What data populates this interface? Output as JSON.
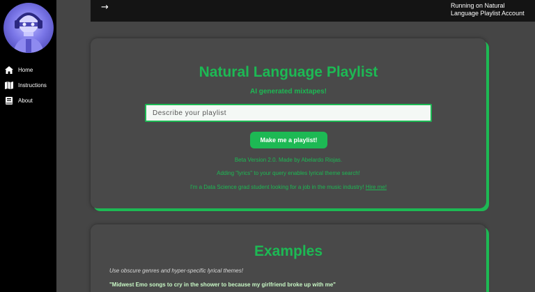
{
  "sidebar": {
    "items": [
      {
        "label": "Home",
        "icon": "home-icon"
      },
      {
        "label": "Instructions",
        "icon": "map-icon"
      },
      {
        "label": "About",
        "icon": "book-icon"
      }
    ]
  },
  "topbar": {
    "arrow": "→",
    "account_text": "Running on Natural Language Playlist Account"
  },
  "main": {
    "title": "Natural Language Playlist",
    "subtitle": "AI generated mixtapes!",
    "search_placeholder": "Describe your playlist",
    "button_label": "Make me a playlist!",
    "info_version": "Beta Version 2.0. Made by Abelardo Riojas.",
    "info_lyrics": "Adding \"lyrics\" to your query enables lyrical theme search!",
    "info_grad": "I'm a Data Science grad student looking for a job in the music industry!",
    "hire_link": "Hire me!"
  },
  "examples": {
    "title": "Examples",
    "note": "Use obscure genres and hyper-specific lyrical themes!",
    "items": [
      "\"Midwest Emo songs to cry in the shower to because my girlfriend broke up with me\""
    ]
  },
  "colors": {
    "accent": "#1db954",
    "sidebar_bg": "#000000",
    "page_bg": "#454545"
  }
}
